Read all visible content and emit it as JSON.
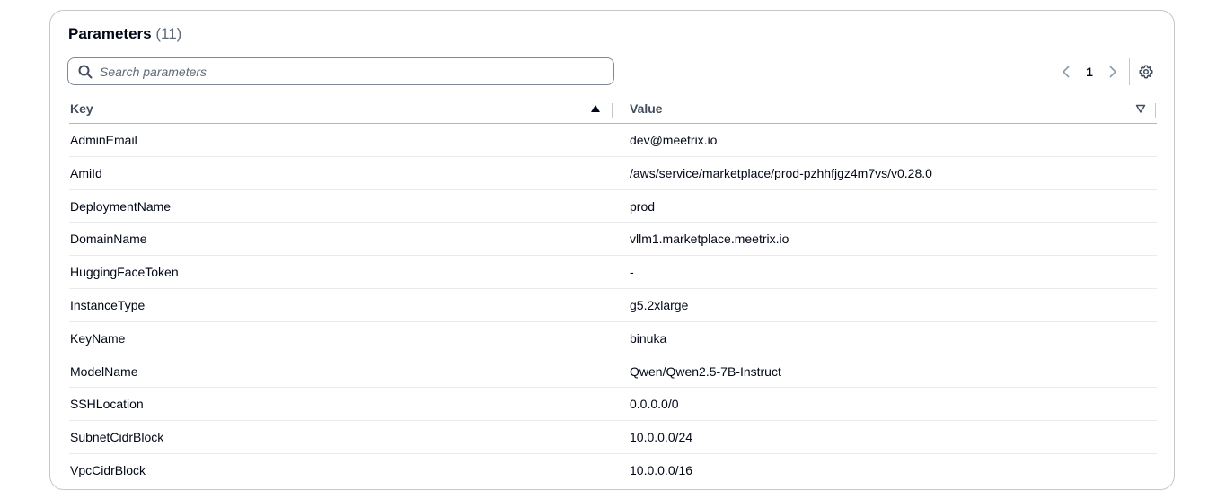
{
  "header": {
    "title": "Parameters",
    "count": "(11)"
  },
  "search": {
    "placeholder": "Search parameters",
    "icon": "search-icon"
  },
  "pagination": {
    "current_page": "1",
    "prev_icon": "chevron-left-icon",
    "next_icon": "chevron-right-icon",
    "settings_icon": "gear-icon"
  },
  "table": {
    "columns": [
      {
        "label": "Key",
        "sort_icon": "sort-ascending-icon"
      },
      {
        "label": "Value",
        "sort_icon": "sort-neutral-icon"
      }
    ],
    "rows": [
      {
        "key": "AdminEmail",
        "value": "dev@meetrix.io"
      },
      {
        "key": "AmiId",
        "value": "/aws/service/marketplace/prod-pzhhfjgz4m7vs/v0.28.0"
      },
      {
        "key": "DeploymentName",
        "value": "prod"
      },
      {
        "key": "DomainName",
        "value": "vllm1.marketplace.meetrix.io"
      },
      {
        "key": "HuggingFaceToken",
        "value": "-"
      },
      {
        "key": "InstanceType",
        "value": "g5.2xlarge"
      },
      {
        "key": "KeyName",
        "value": "binuka"
      },
      {
        "key": "ModelName",
        "value": "Qwen/Qwen2.5-7B-Instruct"
      },
      {
        "key": "SSHLocation",
        "value": "0.0.0.0/0"
      },
      {
        "key": "SubnetCidrBlock",
        "value": "10.0.0.0/24"
      },
      {
        "key": "VpcCidrBlock",
        "value": "10.0.0.0/16"
      }
    ]
  }
}
